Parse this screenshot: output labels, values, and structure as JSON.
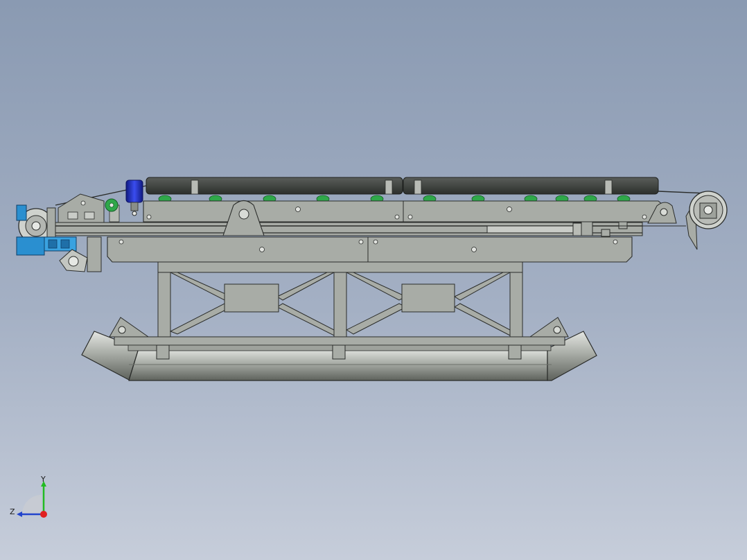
{
  "view": {
    "background_top": "#8a9ab2",
    "background_bottom": "#c6cdda"
  },
  "model": {
    "frame_color": "#a8aca6",
    "outline_color": "#2a2c2a",
    "belt_color": "#3a3d3a",
    "roller_color": "#2fa84a",
    "motor_color": "#2a8fd0",
    "sensor_color": "#2233cc"
  },
  "triad": {
    "y_label": "Y",
    "z_label": "Z",
    "x_color": "#e02020",
    "y_color": "#22bb22",
    "z_color": "#2244cc"
  }
}
